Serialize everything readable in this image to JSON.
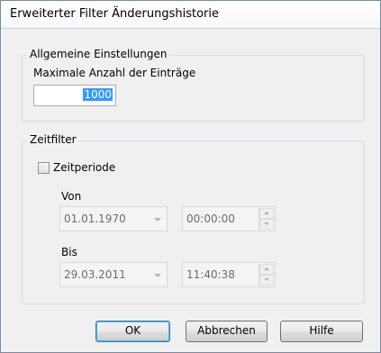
{
  "window": {
    "title": "Erweiterter Filter Änderungshistorie"
  },
  "general": {
    "legend": "Allgemeine Einstellungen",
    "max_label": "Maximale Anzahl der Einträge",
    "max_value": "1000"
  },
  "timefilter": {
    "legend": "Zeitfilter",
    "period_label": "Zeitperiode",
    "period_checked": false,
    "from_label": "Von",
    "from_date": "01.01.1970",
    "from_time": "00:00:00",
    "to_label": "Bis",
    "to_date": "29.03.2011",
    "to_time": "11:40:38"
  },
  "buttons": {
    "ok": "OK",
    "cancel": "Abbrechen",
    "help": "Hilfe"
  },
  "colors": {
    "selection": "#3399ff",
    "default_button_border": "#3c7fb1"
  }
}
